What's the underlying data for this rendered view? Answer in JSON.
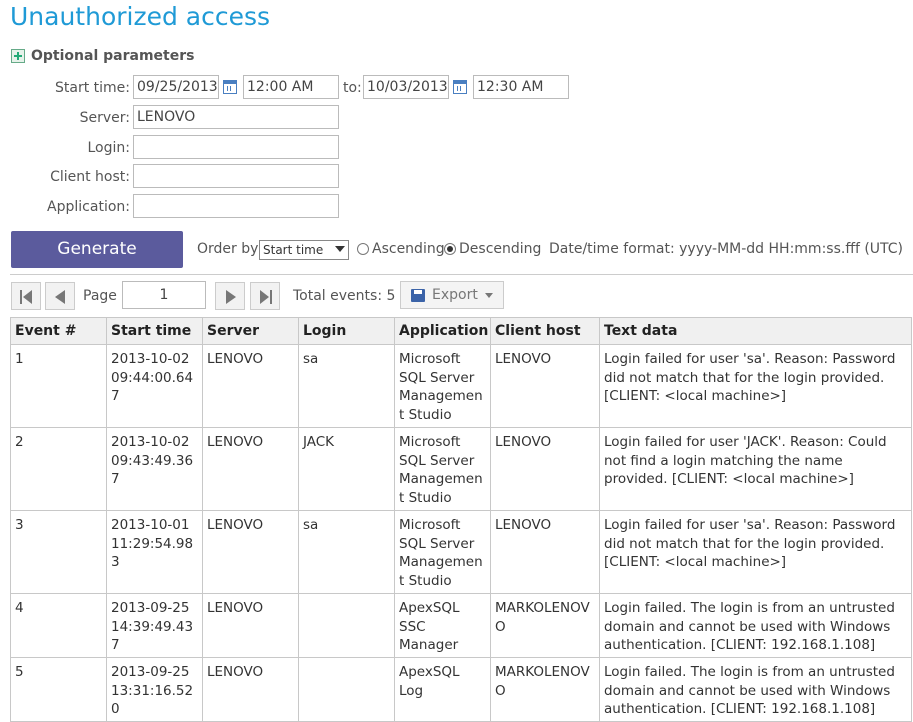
{
  "title": "Unauthorized access",
  "optional_parameters": "Optional parameters",
  "fields": {
    "start_time_label": "Start time:",
    "start_date": "09/25/2013",
    "start_clock": "12:00 AM",
    "to_label": "to:",
    "end_date": "10/03/2013",
    "end_clock": "12:30 AM",
    "server_label": "Server:",
    "server_value": "LENOVO",
    "login_label": "Login:",
    "login_value": "",
    "client_host_label": "Client host:",
    "client_host_value": "",
    "application_label": "Application:",
    "application_value": ""
  },
  "controls": {
    "generate": "Generate",
    "order_by_label": "Order by",
    "order_by_value": "Start time",
    "ascending": "Ascending",
    "descending": "Descending",
    "selected_order": "Descending",
    "datetime_format": "Date/time format: yyyy-MM-dd HH:mm:ss.fff (UTC)"
  },
  "pager": {
    "page_label": "Page",
    "page_value": "1",
    "total_events": "Total events: 5",
    "export": "Export"
  },
  "table": {
    "headers": [
      "Event #",
      "Start time",
      "Server",
      "Login",
      "Application",
      "Client host",
      "Text data"
    ],
    "rows": [
      [
        "1",
        "2013-10-02 09:44:00.647",
        "LENOVO",
        "sa",
        "Microsoft SQL Server Management Studio",
        "LENOVO",
        "Login failed for user 'sa'. Reason: Password did not match that for the login provided. [CLIENT: <local machine>]"
      ],
      [
        "2",
        "2013-10-02 09:43:49.367",
        "LENOVO",
        "JACK",
        "Microsoft SQL Server Management Studio",
        "LENOVO",
        "Login failed for user 'JACK'. Reason: Could not find a login matching the name provided. [CLIENT: <local machine>]"
      ],
      [
        "3",
        "2013-10-01 11:29:54.983",
        "LENOVO",
        "sa",
        "Microsoft SQL Server Management Studio",
        "LENOVO",
        "Login failed for user 'sa'. Reason: Password did not match that for the login provided. [CLIENT: <local machine>]"
      ],
      [
        "4",
        "2013-09-25 14:39:49.437",
        "LENOVO",
        "",
        "ApexSQL SSC Manager",
        "MARKOLENOVO",
        "Login failed. The login is from an untrusted domain and cannot be used with Windows authentication. [CLIENT: 192.168.1.108]"
      ],
      [
        "5",
        "2013-09-25 13:31:16.520",
        "LENOVO",
        "",
        "ApexSQL Log",
        "MARKOLENOVO",
        "Login failed. The login is from an untrusted domain and cannot be used with Windows authentication. [CLIENT: 192.168.1.108]"
      ]
    ]
  }
}
